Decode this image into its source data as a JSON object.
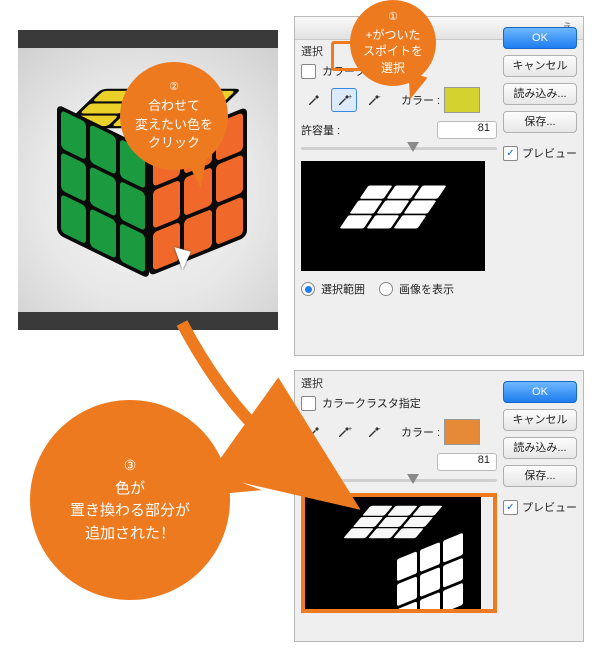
{
  "dialog": {
    "titlebar_partial": "え",
    "selection_label": "選択",
    "cluster_checkbox_partial": "カラーク",
    "cluster_checkbox_full": "カラークラスタ指定",
    "color_label": "カラー :",
    "tolerance_label": "許容量 :",
    "tolerance_value": "81",
    "radio_range": "選択範囲",
    "radio_image": "画像を表示"
  },
  "side": {
    "ok": "OK",
    "cancel": "キャンセル",
    "load": "読み込み...",
    "save": "保存...",
    "preview": "プレビュー"
  },
  "callouts": {
    "c1": {
      "num": "①",
      "l1": "+がついた",
      "l2": "スポイトを",
      "l3": "選択"
    },
    "c2": {
      "num": "②",
      "l1": "合わせて",
      "l2": "変えたい色を",
      "l3": "クリック"
    },
    "c3": {
      "num": "③",
      "l1": "色が",
      "l2": "置き換わる部分が",
      "l3": "追加された！"
    }
  },
  "icons": {
    "eyedropper": "eyedropper-icon",
    "eyedropper_plus": "eyedropper-plus-icon",
    "eyedropper_minus": "eyedropper-minus-icon"
  },
  "colors": {
    "swatch_top": "#d4d22f",
    "swatch_bottom": "#e78a37",
    "accent": "#ee7a20",
    "ok_button": "#1e7df0"
  }
}
